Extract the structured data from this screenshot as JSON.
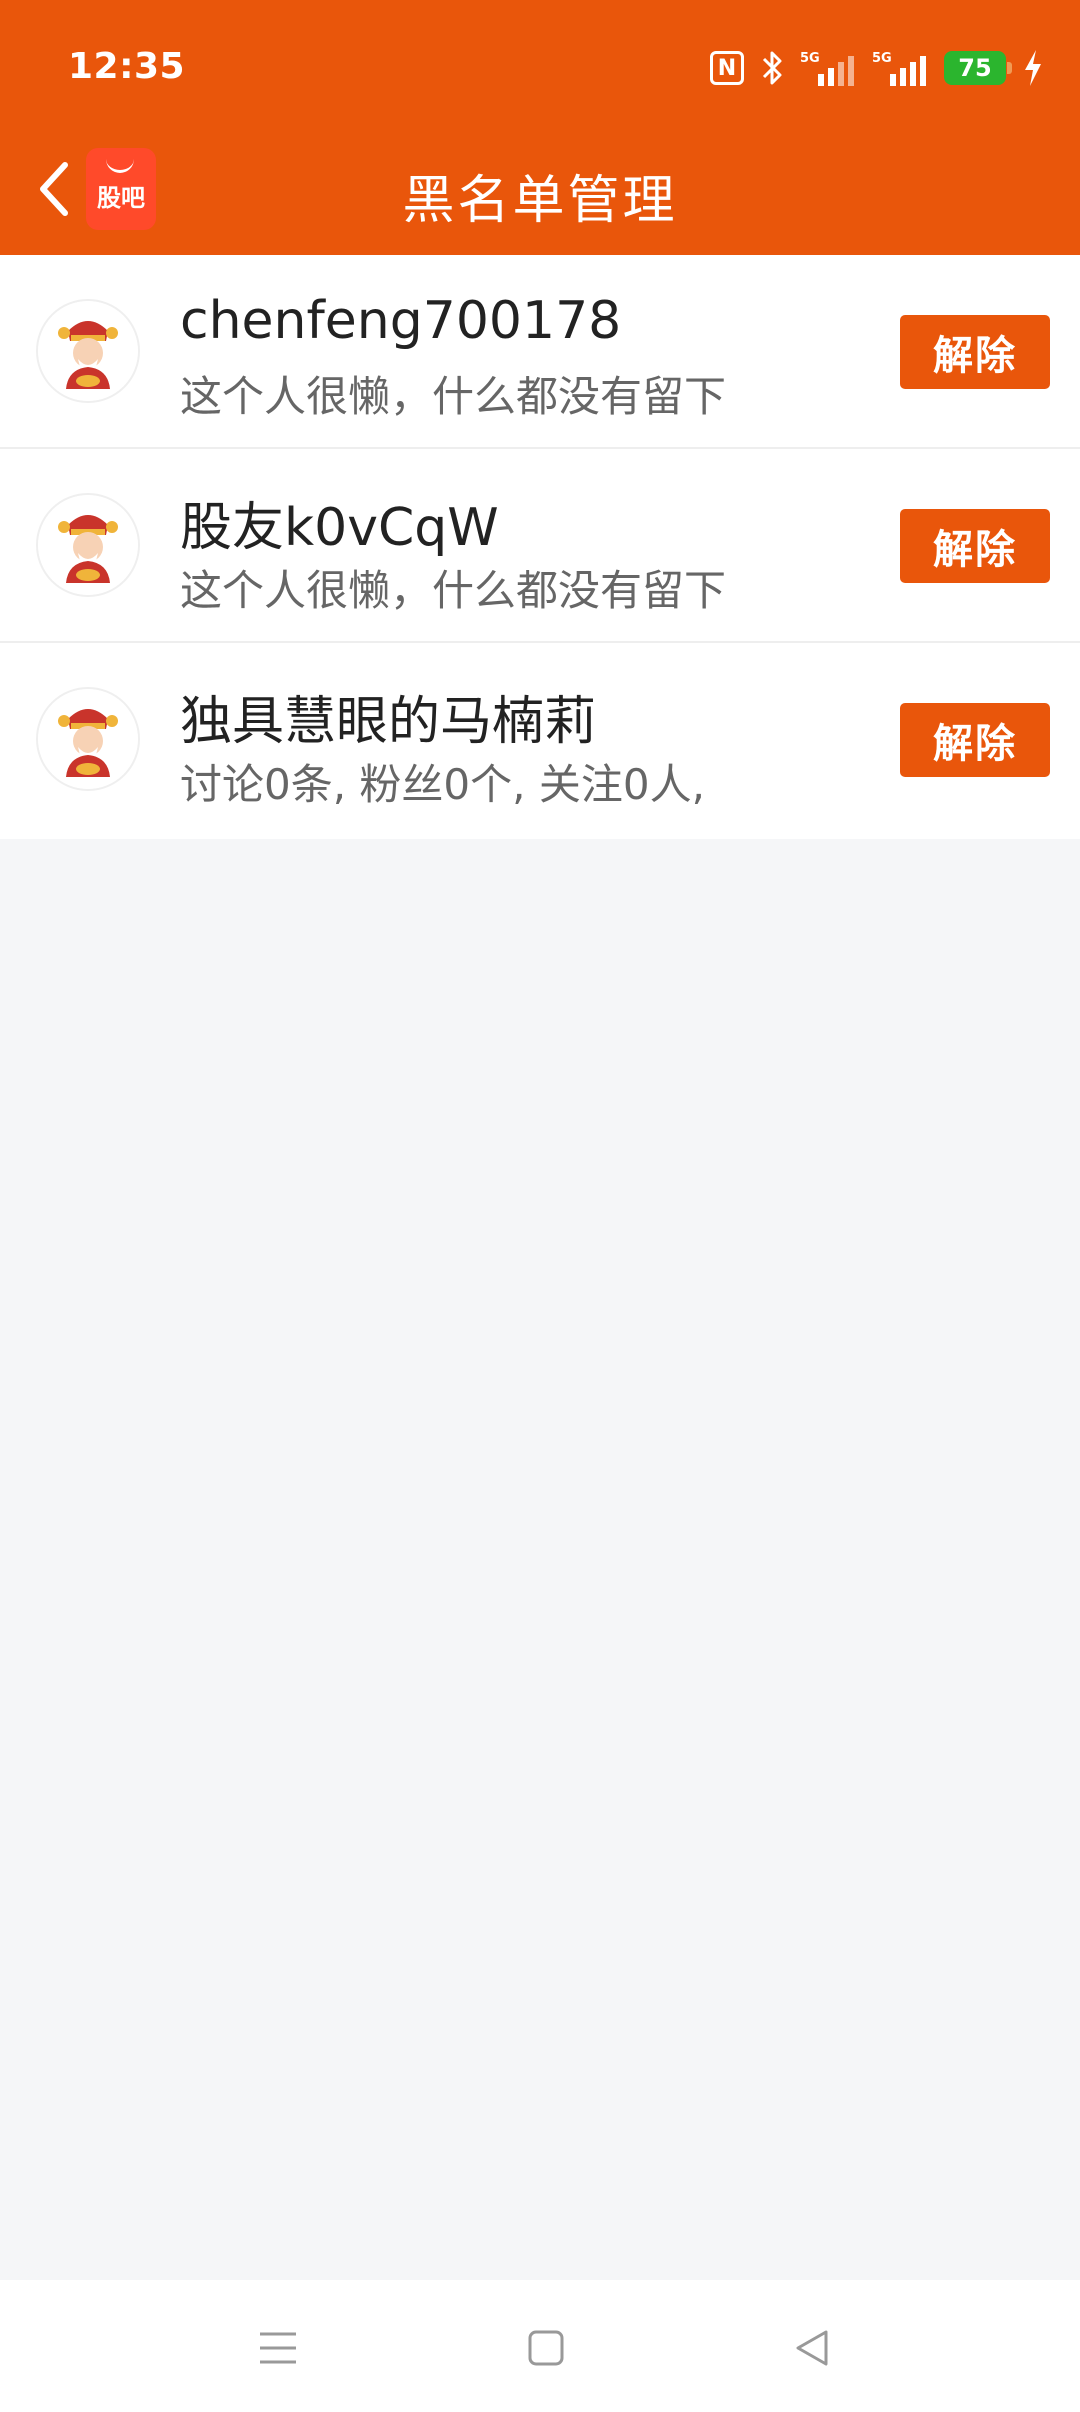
{
  "status_bar": {
    "time": "12:35",
    "battery_level": "75",
    "icons": [
      "nfc-icon",
      "bluetooth-icon",
      "signal-5g-icon",
      "signal-5g-icon",
      "battery-icon",
      "charging-bolt-icon"
    ]
  },
  "header": {
    "title": "黑名单管理",
    "app_badge_label": "股吧",
    "back_icon": "chevron-left-icon"
  },
  "blacklist": {
    "remove_label": "解除",
    "items": [
      {
        "name": "chenfeng700178",
        "desc": "这个人很懒，什么都没有留下"
      },
      {
        "name": "股友k0vCqW",
        "desc": "这个人很懒，什么都没有留下"
      },
      {
        "name": "独具慧眼的马楠莉",
        "desc": "讨论0条, 粉丝0个, 关注0人,"
      }
    ]
  },
  "colors": {
    "brand_orange": "#e9560b",
    "battery_green": "#2bb52e",
    "background": "#f5f6f8"
  },
  "system_nav": {
    "icons": [
      "menu-icon",
      "home-icon",
      "back-triangle-icon"
    ]
  }
}
